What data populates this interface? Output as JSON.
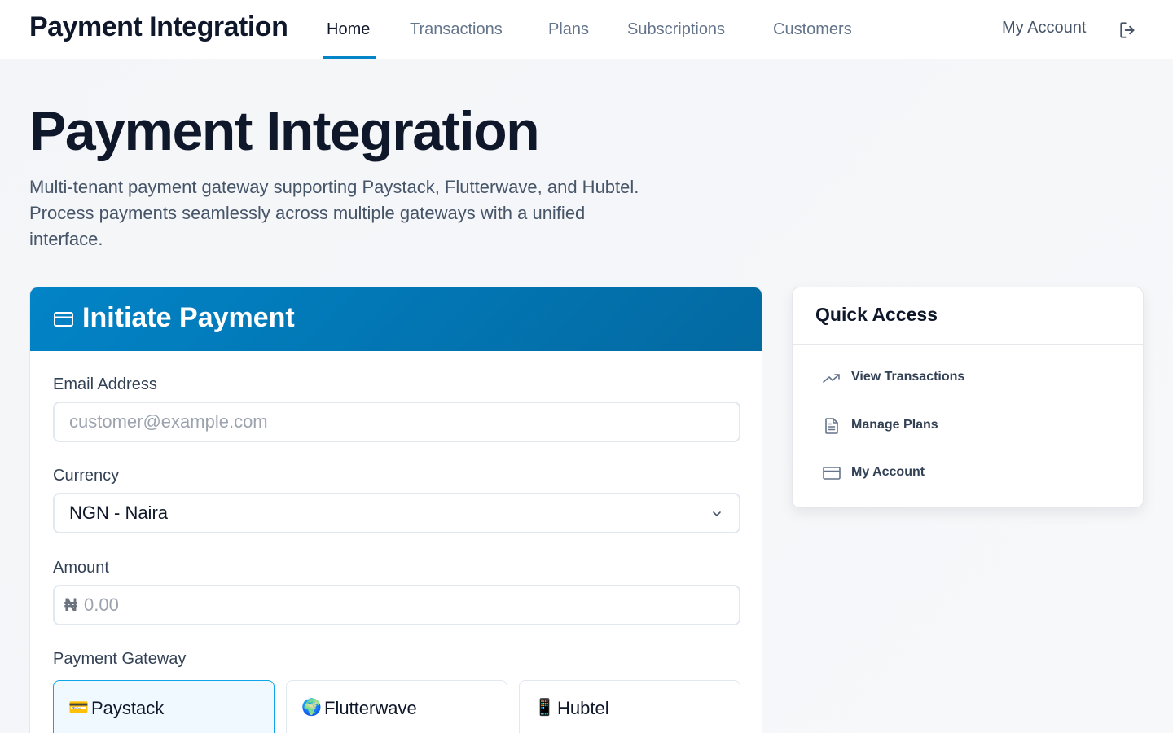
{
  "header": {
    "brand": "Payment Integration",
    "nav": [
      {
        "label": "Home",
        "active": true
      },
      {
        "label": "Transactions"
      },
      {
        "label": "Plans"
      },
      {
        "label": "Subscriptions"
      },
      {
        "label": "Customers"
      }
    ],
    "account_label": "My Account",
    "logout_icon": "logout-icon"
  },
  "hero": {
    "title": "Payment Integration",
    "description": "Multi-tenant payment gateway supporting Paystack, Flutterwave, and Hubtel. Process payments seamlessly across multiple gateways with a unified interface."
  },
  "payment_form": {
    "title": "Initiate Payment",
    "icon": "credit-card-icon",
    "email": {
      "label": "Email Address",
      "placeholder": "customer@example.com",
      "value": ""
    },
    "currency": {
      "label": "Currency",
      "selected": "NGN - Naira"
    },
    "amount": {
      "label": "Amount",
      "symbol": "₦",
      "placeholder": "0.00",
      "value": ""
    },
    "gateway": {
      "label": "Payment Gateway",
      "options": [
        {
          "emoji": "💳",
          "label": "Paystack",
          "selected": true
        },
        {
          "emoji": "🌍",
          "label": "Flutterwave",
          "selected": false
        },
        {
          "emoji": "📱",
          "label": "Hubtel",
          "selected": false
        }
      ]
    }
  },
  "quick_access": {
    "title": "Quick Access",
    "items": [
      {
        "icon": "trending-up-icon",
        "label": "View Transactions"
      },
      {
        "icon": "document-icon",
        "label": "Manage Plans"
      },
      {
        "icon": "credit-card-icon",
        "label": "My Account"
      }
    ]
  },
  "colors": {
    "accent": "#0284c7",
    "accent_dark": "#0369a1",
    "selected_bg": "#f0f9ff",
    "text_primary": "#0f172a",
    "text_muted": "#64748b"
  }
}
